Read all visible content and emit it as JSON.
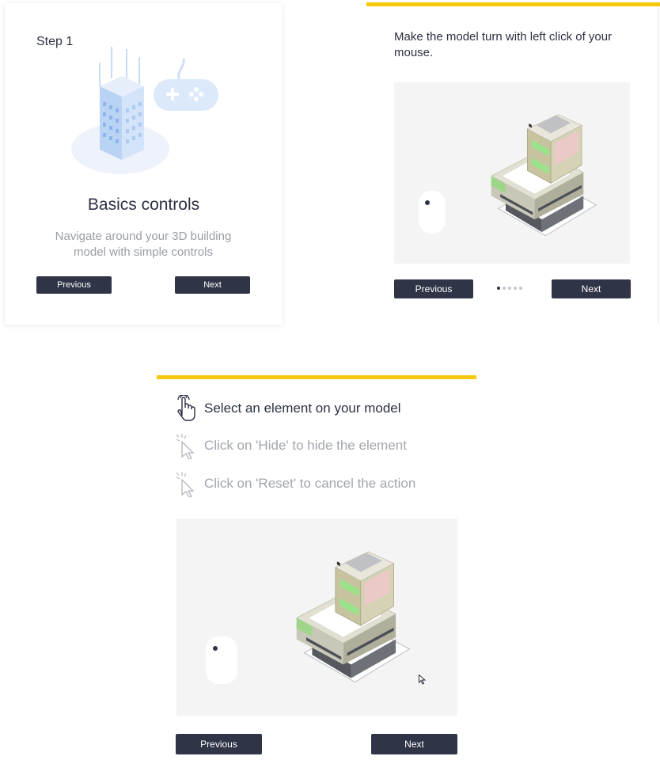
{
  "card1": {
    "step_label": "Step 1",
    "title": "Basics controls",
    "description": "Navigate around your 3D building model with simple controls",
    "prev_label": "Previous",
    "next_label": "Next"
  },
  "card2": {
    "instruction": "Make the model turn with left click of your mouse.",
    "prev_label": "Previous",
    "next_label": "Next",
    "pagination": {
      "total": 5,
      "current": 1
    }
  },
  "card3": {
    "steps": [
      {
        "label": "Select an element on your model",
        "icon": "hand-pointer-icon",
        "active": true
      },
      {
        "label": "Click on 'Hide' to hide the element",
        "icon": "cursor-click-icon",
        "active": false
      },
      {
        "label": "Click on 'Reset' to cancel the action",
        "icon": "cursor-click-icon",
        "active": false
      }
    ],
    "prev_label": "Previous",
    "next_label": "Next"
  },
  "colors": {
    "accent_yellow": "#f6c90e",
    "button_dark": "#2f3447",
    "text_dark": "#2b3042",
    "text_muted": "#9a9da6",
    "panel_bg": "#f4f4f4"
  }
}
